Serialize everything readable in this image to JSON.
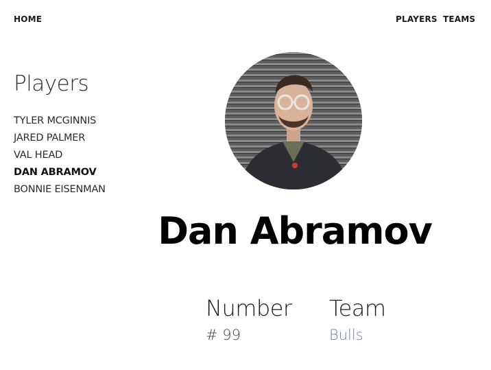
{
  "nav": {
    "home": "HOME",
    "players": "PLAYERS",
    "teams": "TEAMS"
  },
  "sidebar": {
    "title": "Players",
    "items": [
      {
        "label": "TYLER MCGINNIS",
        "active": false
      },
      {
        "label": "JARED PALMER",
        "active": false
      },
      {
        "label": "VAL HEAD",
        "active": false
      },
      {
        "label": "DAN ABRAMOV",
        "active": true
      },
      {
        "label": "BONNIE EISENMAN",
        "active": false
      }
    ]
  },
  "player": {
    "name": "Dan Abramov",
    "number_label": "Number",
    "number_value": "# 99",
    "team_label": "Team",
    "team_value": "Bulls"
  }
}
